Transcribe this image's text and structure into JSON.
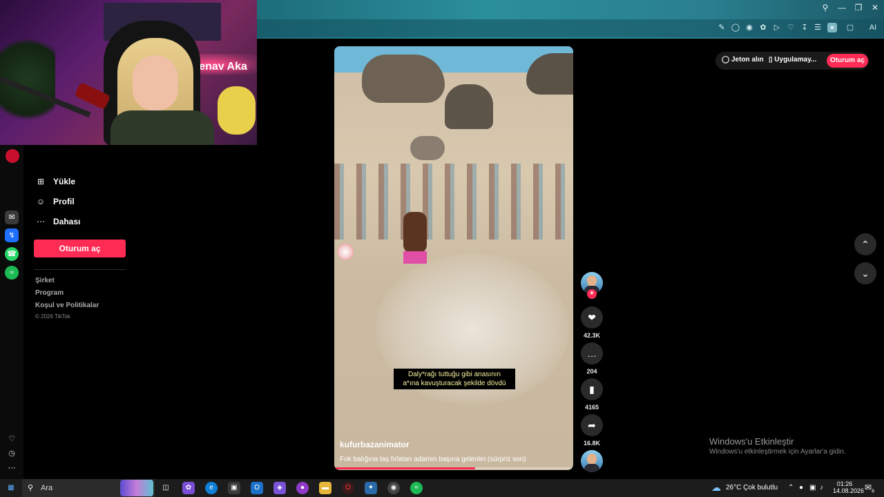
{
  "browser": {
    "toolbar_icons": [
      "edit-icon",
      "camera-icon",
      "shield-icon",
      "extension-icon",
      "play-icon",
      "heart-icon",
      "download-icon",
      "menu-icon",
      "profile-icon",
      "box-icon",
      "ai-icon"
    ],
    "ai_label": "AI"
  },
  "webcam": {
    "neon_text": "renav Aka"
  },
  "sidebar": {
    "items": [
      {
        "icon": "plus-square-icon",
        "label": "Yükle"
      },
      {
        "icon": "person-icon",
        "label": "Profil"
      },
      {
        "icon": "more-icon",
        "label": "Dahası"
      }
    ],
    "login_label": "Oturum aç",
    "footer": [
      "Şirket",
      "Program",
      "Koşul ve Politikalar"
    ],
    "copyright": "© 2026 TikTok"
  },
  "video": {
    "subtitle_line1": "Daly*rağı tuttuğu gibi anasının",
    "subtitle_line2": "a*ına kavuşturacak şekilde dövdü",
    "creator": "kufurbazanimator",
    "caption": "Fok balığına taş fırlatan adamın başına gelenler.(sürpriz son)",
    "progress": 0.59
  },
  "actions": {
    "likes": "42.3K",
    "comments": "204",
    "saves": "4165",
    "shares": "16.8K"
  },
  "top_actions": {
    "coins": "Jeton alın",
    "app": "Uygulamay...",
    "login": "Oturum aç"
  },
  "watermark": {
    "title": "Windows'u Etkinleştir",
    "subtitle": "Windows'u etkinleştirmek için Ayarlar'a gidin."
  },
  "taskbar": {
    "search_placeholder": "Ara",
    "weather": "26°C  Çok bulutlu",
    "time": "01:26",
    "date": "14.08.2026",
    "notifications": "6"
  },
  "colors": {
    "accent": "#fe2c55",
    "chrome": "#2b8f9b"
  }
}
